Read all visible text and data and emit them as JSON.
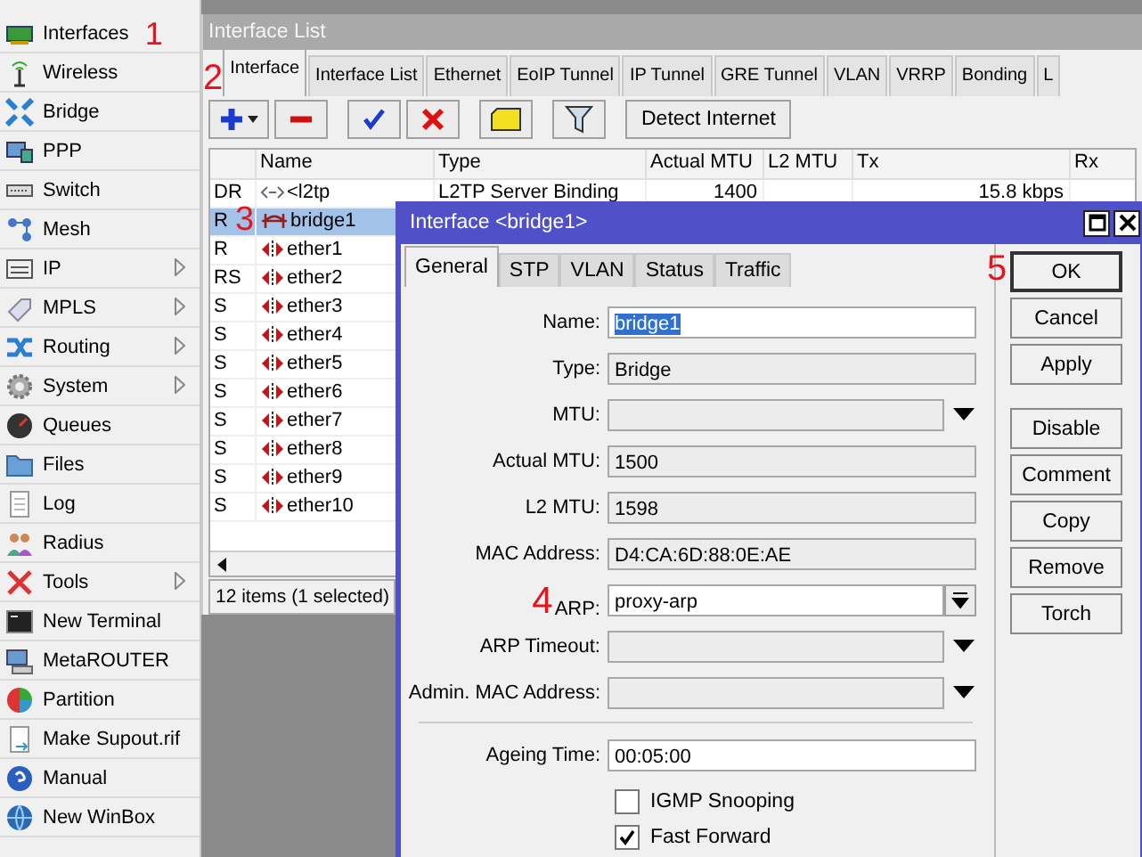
{
  "sidebar": {
    "items": [
      {
        "label": "Interfaces",
        "has_submenu": false,
        "annotation": "1"
      },
      {
        "label": "Wireless",
        "has_submenu": false
      },
      {
        "label": "Bridge",
        "has_submenu": false
      },
      {
        "label": "PPP",
        "has_submenu": false
      },
      {
        "label": "Switch",
        "has_submenu": false
      },
      {
        "label": "Mesh",
        "has_submenu": false
      },
      {
        "label": "IP",
        "has_submenu": true
      },
      {
        "label": "MPLS",
        "has_submenu": true
      },
      {
        "label": "Routing",
        "has_submenu": true
      },
      {
        "label": "System",
        "has_submenu": true
      },
      {
        "label": "Queues",
        "has_submenu": false
      },
      {
        "label": "Files",
        "has_submenu": false
      },
      {
        "label": "Log",
        "has_submenu": false
      },
      {
        "label": "Radius",
        "has_submenu": false
      },
      {
        "label": "Tools",
        "has_submenu": true
      },
      {
        "label": "New Terminal",
        "has_submenu": false
      },
      {
        "label": "MetaROUTER",
        "has_submenu": false
      },
      {
        "label": "Partition",
        "has_submenu": false
      },
      {
        "label": "Make Supout.rif",
        "has_submenu": false
      },
      {
        "label": "Manual",
        "has_submenu": false
      },
      {
        "label": "New WinBox",
        "has_submenu": false
      }
    ]
  },
  "interface_list": {
    "title": "Interface List",
    "tabs": [
      {
        "label": "Interface",
        "selected": true,
        "annotation": "2"
      },
      {
        "label": "Interface List",
        "selected": false
      },
      {
        "label": "Ethernet",
        "selected": false
      },
      {
        "label": "EoIP Tunnel",
        "selected": false
      },
      {
        "label": "IP Tunnel",
        "selected": false
      },
      {
        "label": "GRE Tunnel",
        "selected": false
      },
      {
        "label": "VLAN",
        "selected": false
      },
      {
        "label": "VRRP",
        "selected": false
      },
      {
        "label": "Bonding",
        "selected": false
      },
      {
        "label": "L",
        "selected": false
      }
    ],
    "toolbar": {
      "detect_button": "Detect Internet"
    },
    "table": {
      "columns": [
        "Name",
        "Type",
        "Actual MTU",
        "L2 MTU",
        "Tx",
        "Rx"
      ],
      "rows": [
        {
          "flags": "DR",
          "kind": "binding",
          "name": "<l2tp",
          "type": "L2TP Server Binding",
          "actual_mtu": "1400",
          "tx": "15.8 kbps",
          "selected": false
        },
        {
          "flags": "R",
          "kind": "bridge",
          "name": "bridge1",
          "selected": true,
          "annotation": "3"
        },
        {
          "flags": "R",
          "kind": "ether",
          "name": "ether1",
          "selected": false
        },
        {
          "flags": "RS",
          "kind": "ether",
          "name": "ether2",
          "selected": false
        },
        {
          "flags": "S",
          "kind": "ether",
          "name": "ether3",
          "selected": false
        },
        {
          "flags": "S",
          "kind": "ether",
          "name": "ether4",
          "selected": false
        },
        {
          "flags": "S",
          "kind": "ether",
          "name": "ether5",
          "selected": false
        },
        {
          "flags": "S",
          "kind": "ether",
          "name": "ether6",
          "selected": false
        },
        {
          "flags": "S",
          "kind": "ether",
          "name": "ether7",
          "selected": false
        },
        {
          "flags": "S",
          "kind": "ether",
          "name": "ether8",
          "selected": false
        },
        {
          "flags": "S",
          "kind": "ether",
          "name": "ether9",
          "selected": false
        },
        {
          "flags": "S",
          "kind": "ether",
          "name": "ether10",
          "selected": false
        }
      ]
    },
    "status_bar": "12 items (1 selected)"
  },
  "dialog": {
    "title": "Interface <bridge1>",
    "tabs": [
      {
        "label": "General",
        "selected": true
      },
      {
        "label": "STP",
        "selected": false
      },
      {
        "label": "VLAN",
        "selected": false
      },
      {
        "label": "Status",
        "selected": false
      },
      {
        "label": "Traffic",
        "selected": false
      }
    ],
    "fields": [
      {
        "label": "Name:",
        "kind": "edit",
        "value": "bridge1",
        "text_selected": true
      },
      {
        "label": "Type:",
        "kind": "readonly",
        "value": "Bridge"
      },
      {
        "label": "MTU:",
        "kind": "select"
      },
      {
        "label": "Actual MTU:",
        "kind": "readonly",
        "value": "1500"
      },
      {
        "label": "L2 MTU:",
        "kind": "readonly",
        "value": "1598"
      },
      {
        "label": "MAC Address:",
        "kind": "readonly",
        "value": "D4:CA:6D:88:0E:AE"
      },
      {
        "label": "ARP:",
        "kind": "combo",
        "value": "proxy-arp",
        "annotation": "4"
      },
      {
        "label": "ARP Timeout:",
        "kind": "select"
      },
      {
        "label": "Admin. MAC Address:",
        "kind": "select"
      }
    ],
    "fields_2": [
      {
        "label": "Ageing Time:",
        "kind": "edit",
        "value": "00:05:00",
        "text_selected": false
      }
    ],
    "checkboxes": [
      {
        "label": "IGMP Snooping",
        "checked": false
      },
      {
        "label": "Fast Forward",
        "checked": true
      }
    ],
    "buttons": [
      {
        "label": "OK",
        "default": true,
        "annotation": "5"
      },
      {
        "label": "Cancel",
        "default": false
      },
      {
        "label": "Apply",
        "default": false
      }
    ],
    "buttons_2": [
      {
        "label": "Disable",
        "default": false
      },
      {
        "label": "Comment",
        "default": false
      },
      {
        "label": "Copy",
        "default": false
      },
      {
        "label": "Remove",
        "default": false
      },
      {
        "label": "Torch",
        "default": false
      }
    ]
  }
}
